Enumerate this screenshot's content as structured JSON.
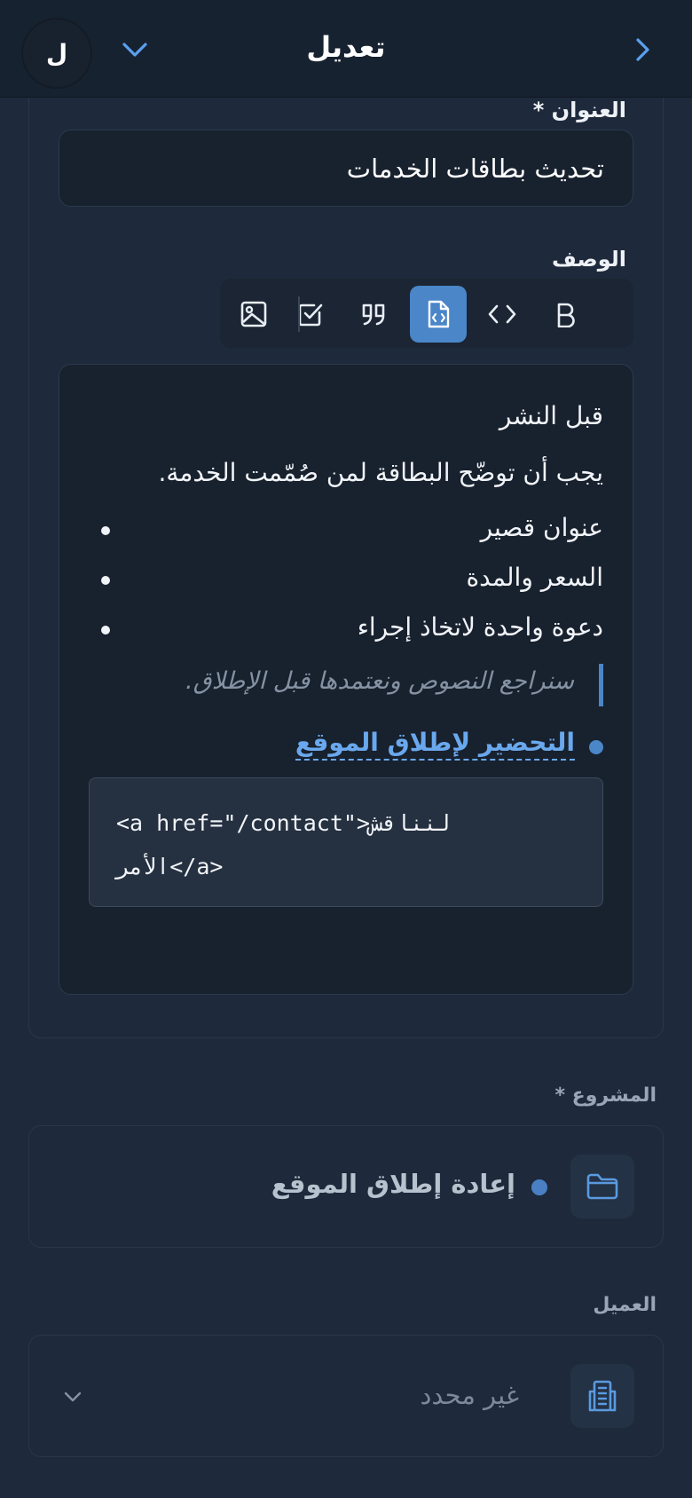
{
  "header": {
    "title": "تعديل",
    "avatar_letter": "ل",
    "icons": [
      "chevron-right-icon",
      "chevron-down-icon"
    ]
  },
  "form": {
    "title_label": "العنوان *",
    "title_value": "تحديث بطاقات الخدمات",
    "description_label": "الوصف",
    "toolbar": [
      {
        "name": "bold",
        "icon": "bold-icon",
        "text": "B"
      },
      {
        "name": "code",
        "icon": "code-icon"
      },
      {
        "name": "code-block",
        "icon": "code-block-icon",
        "active": true
      },
      {
        "name": "quote",
        "icon": "quote-icon"
      },
      {
        "name": "task",
        "icon": "checkbox-icon"
      },
      {
        "name": "image",
        "icon": "image-icon"
      }
    ],
    "editor": {
      "heading": "قبل النشر",
      "paragraph": "يجب أن توضّح البطاقة لمن صُمّمت الخدمة.",
      "bullets": [
        "عنوان قصير",
        "السعر والمدة",
        "دعوة واحدة لاتخاذ إجراء"
      ],
      "quote": "سنراجع النصوص ونعتمدها قبل الإطلاق.",
      "task_link": "التحضير لإطلاق الموقع",
      "code_line1": "<a href=\"/contact\">لنناقش",
      "code_line2": "الأمر</a>"
    }
  },
  "project": {
    "label": "المشروع *",
    "value": "إعادة إطلاق الموقع",
    "icon": "folder-icon",
    "dot_color": "#4a7fc4"
  },
  "client": {
    "label": "العميل",
    "value": "غير محدد",
    "icon": "building-icon"
  },
  "colors": {
    "accent": "#4a86c8",
    "background": "#1e2a3b",
    "surface": "#18212e"
  }
}
